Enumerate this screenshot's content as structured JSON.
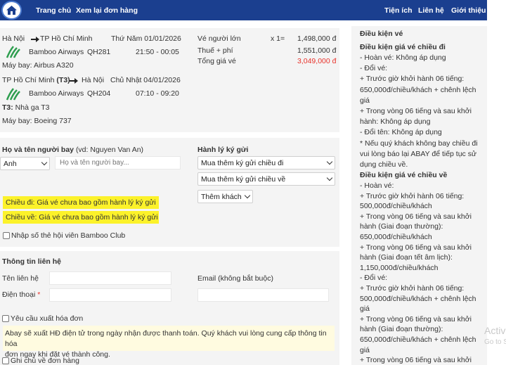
{
  "nav": {
    "home": "Trang chủ",
    "review": "Xem lại đơn hàng",
    "utilities": "Tiện ích",
    "contact": "Liên hệ",
    "about": "Giới thiệu"
  },
  "outbound": {
    "from": "Hà Nội",
    "to": "TP Hồ Chí Minh",
    "date": "Thứ Năm 01/01/2026",
    "airline": "Bamboo Airways",
    "flight_no": "QH281",
    "time": "21:50 - 00:05",
    "aircraft": "Máy bay: Airbus A320"
  },
  "return": {
    "from": "TP Hồ Chí Minh",
    "from_terminal": "(T3)",
    "to": "Hà Nội",
    "date": "Chủ Nhật 04/01/2026",
    "airline": "Bamboo Airways",
    "flight_no": "QH204",
    "time": "07:10 - 09:20",
    "terminal_code": "T3:",
    "terminal_name": "Nhà ga T3",
    "aircraft": "Máy bay: Boeing 737"
  },
  "pricing": {
    "adult_label": "Vé người lớn",
    "adult_qty": "x 1=",
    "adult_price": "1,498,000 đ",
    "tax_label": "Thuế + phí",
    "tax_price": "1,551,000 đ",
    "total_label": "Tổng giá vé",
    "total_price": "3,049,000 đ"
  },
  "passenger": {
    "name_label": "Họ và tên người bay",
    "name_hint": "(vd: Nguyen Van An)",
    "title_value": "Anh",
    "name_placeholder": "Họ và tên người bay...",
    "baggage_label": "Hành lý ký gửi",
    "baggage_out": "Mua thêm ký gửi chiều đi",
    "baggage_ret": "Mua thêm ký gửi chiều về",
    "add_pax": "Thêm khách",
    "note_out": "Chiều đi:  Giá vé chưa bao gồm hành lý ký gửi",
    "note_ret": "Chiều về:  Giá vé chưa bao gồm hành lý ký gửi",
    "member_label": "Nhập số thẻ hội viên Bamboo Club"
  },
  "contact": {
    "section_title": "Thông tin liên hệ",
    "name_label": "Tên liên hệ",
    "phone_label": "Điện thoại",
    "required_mark": "*",
    "email_label": "Email (không bắt buộc)",
    "invoice_label": "Yêu cầu xuất hóa đơn",
    "invoice_note_1": "Abay sẽ xuất HĐ điện tử trong ngày nhận được thanh toán. Quý khách vui lòng cung cấp thông tin hóa",
    "invoice_note_2": "đơn ngay khi đặt vé thành công.",
    "order_note_label": "Ghi chú về đơn hàng"
  },
  "conditions": {
    "title": "Điều kiện vé",
    "out_title": "Điều kiện giá vé chiều đi",
    "out_lines": [
      "- Hoàn vé: Không áp dụng",
      "- Đổi vé:",
      "+ Trước giờ khởi hành 06 tiếng:",
      "650,000đ/chiều/khách + chênh lệch",
      "giá",
      "+ Trong vòng 06 tiếng và sau khởi",
      "hành: Không áp dụng",
      "- Đổi tên: Không áp dụng",
      "* Nếu quý khách không bay chiều đi",
      "vui lòng báo lại ABAY để tiếp tục sử",
      "dụng chiều về."
    ],
    "ret_title": "Điều kiện giá vé chiều về",
    "ret_lines": [
      "- Hoàn vé:",
      "+ Trước giờ khởi hành 06 tiếng:",
      "500,000đ/chiều/khách",
      "+ Trong vòng 06 tiếng và sau khởi",
      "hành (Giai đoạn thường):",
      "650,000đ/chiều/khách",
      "+ Trong vòng 06 tiếng và sau khởi",
      "hành (Giai đoạn tết âm lịch):",
      "1,150,000đ/chiều/khách",
      "- Đổi vé:",
      "+ Trước giờ khởi hành 06 tiếng:",
      "500,000đ/chiều/khách + chênh lệch",
      "giá",
      "+ Trong vòng 06 tiếng và sau khởi",
      "hành (Giai đoạn thường):",
      "650,000đ/chiều/khách + chênh lệch",
      "giá",
      "+ Trong vòng 06 tiếng và sau khởi"
    ]
  },
  "watermark": {
    "line1": "Activ",
    "line2": "Go to S"
  },
  "colors": {
    "nav_bg": "#1b3f8f",
    "total_price": "#e8322b",
    "highlight": "#fcf22a",
    "airline_green": "#2e9e4f"
  }
}
